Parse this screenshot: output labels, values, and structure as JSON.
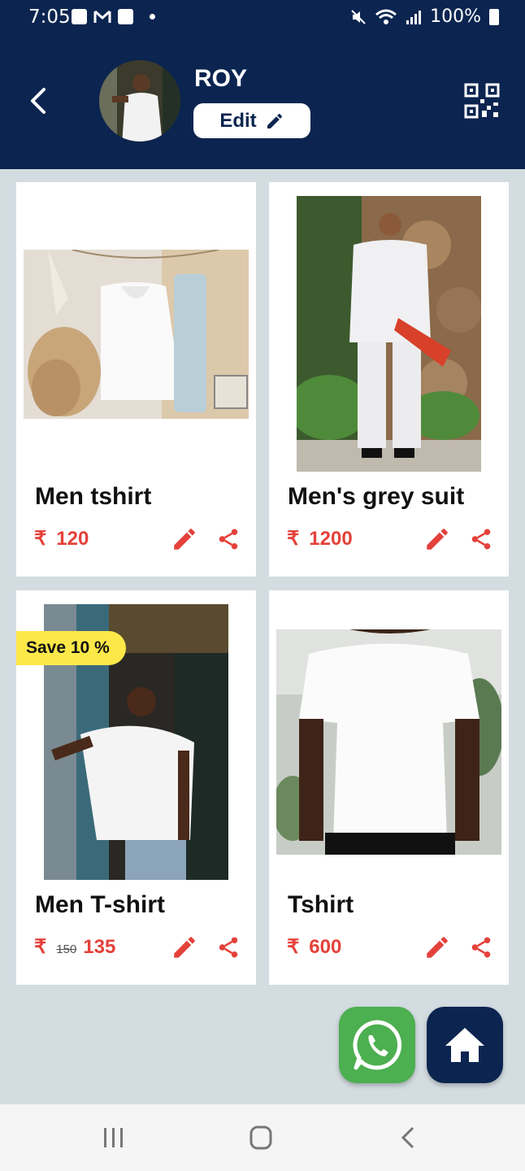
{
  "status_bar": {
    "time": "7:05",
    "battery": "100%"
  },
  "profile": {
    "name": "ROY",
    "edit_label": "Edit"
  },
  "products": [
    {
      "title": "Men tshirt",
      "currency": "₹",
      "price": "120"
    },
    {
      "title": "Men's grey suit",
      "currency": "₹",
      "price": "1200"
    },
    {
      "title": "Men T-shirt",
      "currency": "₹",
      "original_price": "150",
      "price": "135",
      "badge": "Save 10 %"
    },
    {
      "title": "Tshirt",
      "currency": "₹",
      "price": "600"
    }
  ],
  "colors": {
    "header": "#0b2550",
    "accent": "#e4413a",
    "badge": "#fde84a",
    "whatsapp": "#4caf50"
  },
  "icons": [
    "back-icon",
    "qr-code-icon",
    "pencil-icon",
    "share-icon",
    "whatsapp-icon",
    "home-icon"
  ]
}
